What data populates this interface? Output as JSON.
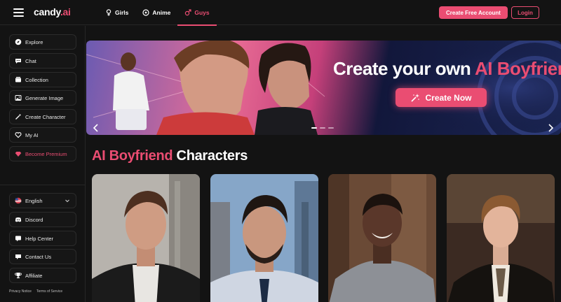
{
  "header": {
    "logo_main": "candy",
    "logo_tld": ".ai",
    "nav": [
      {
        "label": "Girls",
        "icon": "female-icon"
      },
      {
        "label": "Anime",
        "icon": "anime-icon"
      },
      {
        "label": "Guys",
        "icon": "male-icon",
        "active": true
      }
    ],
    "create_account_label": "Create Free Account",
    "login_label": "Login"
  },
  "sidebar": {
    "items": [
      {
        "label": "Explore",
        "icon": "compass-icon"
      },
      {
        "label": "Chat",
        "icon": "chat-icon"
      },
      {
        "label": "Collection",
        "icon": "collection-icon"
      },
      {
        "label": "Generate Image",
        "icon": "image-icon"
      },
      {
        "label": "Create Character",
        "icon": "wand-icon"
      },
      {
        "label": "My AI",
        "icon": "heart-icon"
      },
      {
        "label": "Become Premium",
        "icon": "diamond-icon"
      }
    ],
    "bottom_items": [
      {
        "label": "English",
        "icon": "flag-icon"
      },
      {
        "label": "Discord",
        "icon": "discord-icon"
      },
      {
        "label": "Help Center",
        "icon": "help-icon"
      },
      {
        "label": "Contact Us",
        "icon": "mail-icon"
      },
      {
        "label": "Affiliate",
        "icon": "trophy-icon"
      }
    ],
    "footer": {
      "privacy": "Privacy Notice",
      "terms": "Terms of Service"
    }
  },
  "banner": {
    "title_main": "Create your own ",
    "title_accent": "AI Boyfriend",
    "cta_label": "Create Now"
  },
  "section": {
    "title_accent": "AI Boyfriend",
    "title_main": " Characters"
  },
  "colors": {
    "accent": "#ea4d72",
    "background": "#131313"
  }
}
